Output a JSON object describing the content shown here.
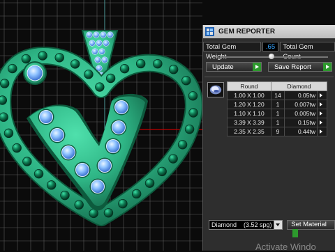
{
  "panel": {
    "title": "GEM REPORTER",
    "total_gem_weight_label": "Total Gem Weight",
    "total_gem_weight_value": ".65",
    "total_gem_count_label": "Total Gem Count",
    "update_label": "Update",
    "save_report_label": "Save Report",
    "table": {
      "col_shape": "Round",
      "col_material": "Diamond",
      "rows": [
        {
          "size": "1.00 X 1.00",
          "count": "14",
          "weight": "0.05tw"
        },
        {
          "size": "1.20 X 1.20",
          "count": "1",
          "weight": "0.007tw"
        },
        {
          "size": "1.10 X 1.10",
          "count": "1",
          "weight": "0.005tw"
        },
        {
          "size": "3.39 X 3.39",
          "count": "1",
          "weight": "0.15tw"
        },
        {
          "size": "2.35 X 2.35",
          "count": "9",
          "weight": "0.44tw"
        }
      ]
    },
    "material_select": "Diamond    (3.52 spg)",
    "set_material_label": "Set Material"
  },
  "watermark": "Activate Windo",
  "icons": {
    "title": "gem-reporter-icon",
    "gem": "round-diamond-icon",
    "dropdown": "chevron-down-icon",
    "play": "green-arrow-icon"
  },
  "colors": {
    "metal": "#2fb686",
    "metal_dark": "#1a7f5c",
    "gem": "#7fb8ff",
    "grid": "#5c5c5c",
    "axis_red": "#c00000",
    "panel_bg": "#2e2e2e",
    "accent_value": "#35a4ff",
    "button_green": "#2d9a2d"
  }
}
